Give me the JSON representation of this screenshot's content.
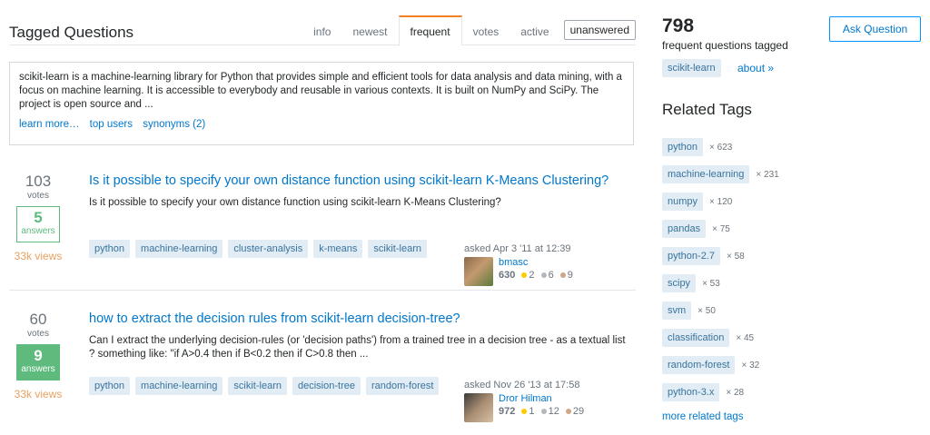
{
  "header": {
    "title": "Tagged Questions",
    "tabs": [
      "info",
      "newest",
      "frequent",
      "votes",
      "active",
      "unanswered"
    ],
    "active_tab": "frequent"
  },
  "wiki": {
    "text": "scikit-learn is a machine-learning library for Python that provides simple and efficient tools for data analysis and data mining, with a focus on machine learning. It is accessible to everybody and reusable in various contexts. It is built on NumPy and SciPy. The project is open source and ...",
    "links": [
      "learn more…",
      "top users",
      "synonyms (2)"
    ]
  },
  "questions": [
    {
      "votes": "103",
      "votes_label": "votes",
      "answers": "5",
      "answers_label": "answers",
      "views": "33k views",
      "title": "Is it possible to specify your own distance function using scikit-learn K-Means Clustering?",
      "excerpt": "Is it possible to specify your own distance function using scikit-learn K-Means Clustering?",
      "tags": [
        "python",
        "machine-learning",
        "cluster-analysis",
        "k-means",
        "scikit-learn"
      ],
      "asked": "asked Apr 3 '11 at 12:39",
      "user": "bmasc",
      "rep": "630",
      "gold": "2",
      "silver": "6",
      "bronze": "9"
    },
    {
      "votes": "60",
      "votes_label": "votes",
      "answers": "9",
      "answers_label": "answers",
      "views": "33k views",
      "title": "how to extract the decision rules from scikit-learn decision-tree?",
      "excerpt": "Can I extract the underlying decision-rules (or 'decision paths') from a trained tree in a decision tree - as a textual list ? something like: \"if A>0.4 then if B<0.2 then if C>0.8 then ...",
      "tags": [
        "python",
        "machine-learning",
        "scikit-learn",
        "decision-tree",
        "random-forest"
      ],
      "asked": "asked Nov 26 '13 at 17:58",
      "user": "Dror Hilman",
      "rep": "972",
      "gold": "1",
      "silver": "12",
      "bronze": "29"
    }
  ],
  "sidebar": {
    "count": "798",
    "count_label": "frequent questions tagged",
    "ask_button": "Ask Question",
    "tag": "scikit-learn",
    "about": "about »",
    "related_title": "Related Tags",
    "related": [
      {
        "tag": "python",
        "count": "× 623"
      },
      {
        "tag": "machine-learning",
        "count": "× 231"
      },
      {
        "tag": "numpy",
        "count": "× 120"
      },
      {
        "tag": "pandas",
        "count": "× 75"
      },
      {
        "tag": "python-2.7",
        "count": "× 58"
      },
      {
        "tag": "scipy",
        "count": "× 53"
      },
      {
        "tag": "svm",
        "count": "× 50"
      },
      {
        "tag": "classification",
        "count": "× 45"
      },
      {
        "tag": "random-forest",
        "count": "× 32"
      },
      {
        "tag": "python-3.x",
        "count": "× 28"
      }
    ],
    "more_related": "more related tags"
  },
  "colors": {
    "link": "#0077cc",
    "accepted": "#5eba7d",
    "views": "#e8a061",
    "tag_bg": "#e1ecf4",
    "tag_text": "#39739d",
    "tab_accent": "#f48024"
  }
}
